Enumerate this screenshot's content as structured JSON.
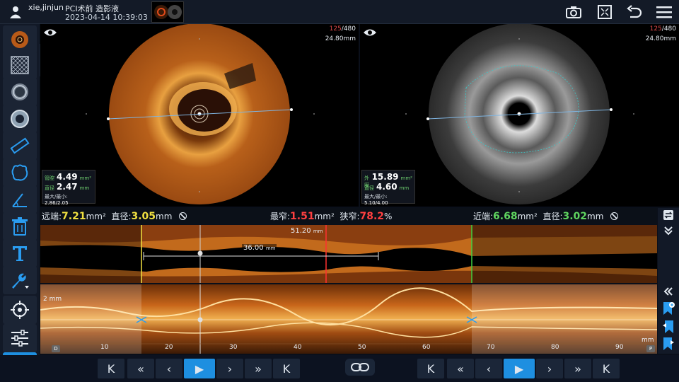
{
  "header": {
    "username": "xie,jinjun",
    "patient_label": "PCI术前 造影液",
    "datetime": "2023-04-14 10:39:03"
  },
  "toolbar_right": {
    "icons": [
      "camera-icon",
      "fit-screen-icon",
      "undo-icon",
      "menu-icon"
    ]
  },
  "left_tools": [
    "oct-view-icon",
    "mesh-icon",
    "lumen-ring-icon",
    "vessel-ring-icon",
    "ruler-icon",
    "area-trace-icon",
    "angle-icon",
    "delete-icon",
    "text-icon",
    "settings-wrench-icon",
    "target-icon",
    "adjust-sliders-icon",
    "add-icon"
  ],
  "view_left": {
    "frame_current": "125",
    "frame_total": "/480",
    "depth": "24.80mm",
    "area_label": "管腔",
    "area_value": "4.49",
    "area_unit": "mm²",
    "diam_label": "直径",
    "diam_value": "2.47",
    "diam_unit": "mm",
    "minmax_label": "最大/最小:",
    "minmax_value": "2.86/2.05"
  },
  "view_right": {
    "frame_current": "125",
    "frame_total": "/480",
    "depth": "24.80mm",
    "area_label": "外膜",
    "area_value": "15.89",
    "area_unit": "mm²",
    "diam_label": "直径",
    "diam_value": "4.60",
    "diam_unit": "mm",
    "minmax_label": "最大/最小:",
    "minmax_value": "5.10/4.00"
  },
  "info_bar": {
    "distal_label": "远端:",
    "distal_area": "7.21",
    "area_unit": "mm²",
    "distal_diam_label": "直径:",
    "distal_diam": "3.05",
    "diam_unit": "mm",
    "min_label": "最窄:",
    "min_area": "1.51",
    "stenosis_label": "狭窄:",
    "stenosis_value": "78.2",
    "stenosis_unit": "%",
    "proximal_label": "近端:",
    "proximal_area": "6.68",
    "proximal_diam_label": "直径:",
    "proximal_diam": "3.02"
  },
  "longitudinal": {
    "length_total": "51.20",
    "length_unit": "mm",
    "length_segment": "36.00"
  },
  "rview": {
    "depth_label": "2 mm",
    "d_marker": "D",
    "p_marker": "P",
    "axis_unit": "mm",
    "ticks": [
      "10",
      "20",
      "30",
      "40",
      "50",
      "60",
      "70",
      "80",
      "90"
    ]
  },
  "playback": {
    "left": [
      "K",
      "«",
      "‹",
      "▶",
      "›",
      "»",
      "K"
    ],
    "right": [
      "K",
      "«",
      "‹",
      "▶",
      "›",
      "»",
      "K"
    ]
  },
  "colors": {
    "accent": "#1e8fe0",
    "distal_yellow": "#f0e040",
    "proximal_green": "#5fd45f",
    "stenosis_red": "#ff4040",
    "oct_orange": "#c8661a"
  }
}
